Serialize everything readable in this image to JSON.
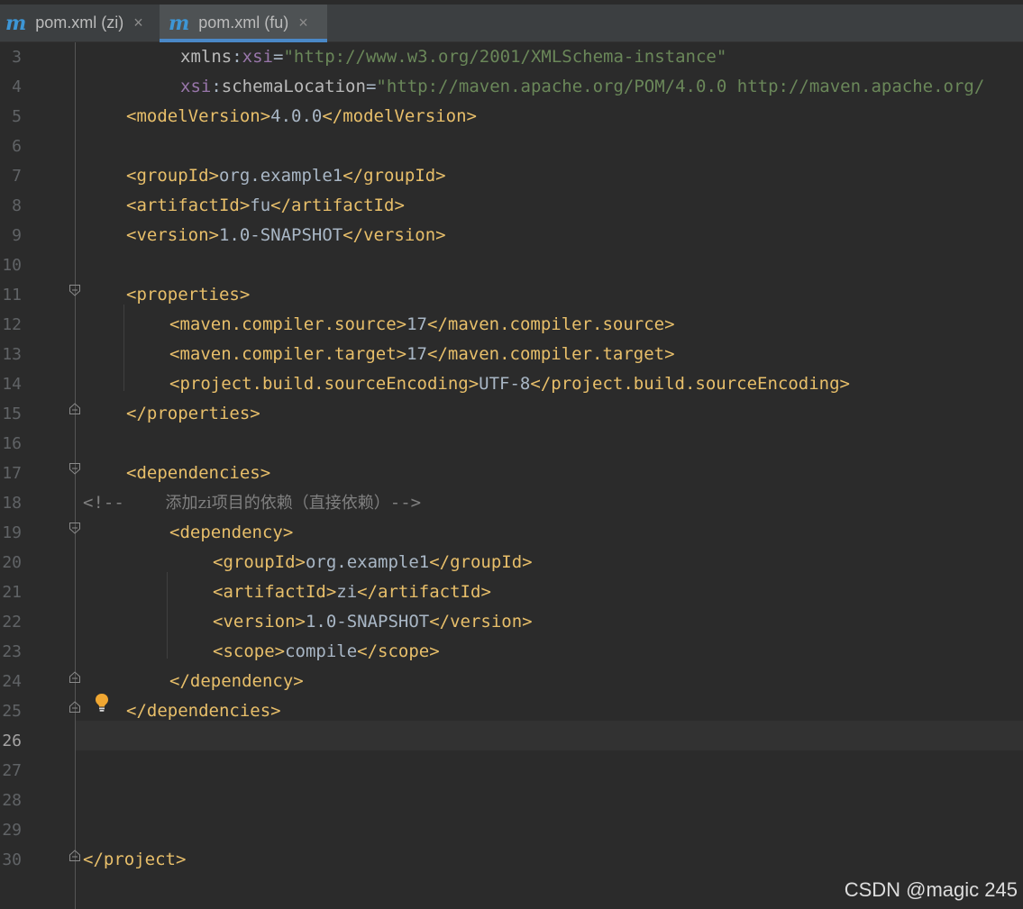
{
  "tabs": [
    {
      "label": "pom.xml (zi)",
      "icon": "maven-m-icon",
      "close": "×",
      "active": false
    },
    {
      "label": "pom.xml (fu)",
      "icon": "maven-m-icon",
      "close": "×",
      "active": true
    }
  ],
  "tab_icon_glyph": "m",
  "editor": {
    "current_line": 26,
    "lines": [
      {
        "n": "3",
        "tokens": [
          [
            "attr",
            "xmlns"
          ],
          [
            "txt",
            ":"
          ],
          [
            "ns",
            "xsi"
          ],
          [
            "txt",
            "="
          ],
          [
            "str",
            "\"http://www.w3.org/2001/XMLSchema-instance\""
          ]
        ]
      },
      {
        "n": "4",
        "tokens": [
          [
            "ns",
            "xsi"
          ],
          [
            "txt",
            ":"
          ],
          [
            "attr",
            "schemaLocation"
          ],
          [
            "txt",
            "="
          ],
          [
            "str",
            "\"http://maven.apache.org/POM/4.0.0 http://maven.apache.org/"
          ]
        ]
      },
      {
        "n": "5",
        "tokens": [
          [
            "tag",
            "<modelVersion>"
          ],
          [
            "txt",
            "4.0.0"
          ],
          [
            "tag",
            "</modelVersion>"
          ]
        ]
      },
      {
        "n": "6",
        "tokens": []
      },
      {
        "n": "7",
        "tokens": [
          [
            "tag",
            "<groupId>"
          ],
          [
            "txt",
            "org.example1"
          ],
          [
            "tag",
            "</groupId>"
          ]
        ]
      },
      {
        "n": "8",
        "tokens": [
          [
            "tag",
            "<artifactId>"
          ],
          [
            "txt",
            "fu"
          ],
          [
            "tag",
            "</artifactId>"
          ]
        ]
      },
      {
        "n": "9",
        "tokens": [
          [
            "tag",
            "<version>"
          ],
          [
            "txt",
            "1.0-SNAPSHOT"
          ],
          [
            "tag",
            "</version>"
          ]
        ]
      },
      {
        "n": "10",
        "tokens": []
      },
      {
        "n": "11",
        "tokens": [
          [
            "tag",
            "<properties>"
          ]
        ]
      },
      {
        "n": "12",
        "tokens": [
          [
            "tag",
            "<maven.compiler.source>"
          ],
          [
            "txt",
            "17"
          ],
          [
            "tag",
            "</maven.compiler.source>"
          ]
        ]
      },
      {
        "n": "13",
        "tokens": [
          [
            "tag",
            "<maven.compiler.target>"
          ],
          [
            "txt",
            "17"
          ],
          [
            "tag",
            "</maven.compiler.target>"
          ]
        ]
      },
      {
        "n": "14",
        "tokens": [
          [
            "tag",
            "<project.build.sourceEncoding>"
          ],
          [
            "txt",
            "UTF-8"
          ],
          [
            "tag",
            "</project.build.sourceEncoding>"
          ]
        ]
      },
      {
        "n": "15",
        "tokens": [
          [
            "tag",
            "</properties>"
          ]
        ]
      },
      {
        "n": "16",
        "tokens": []
      },
      {
        "n": "17",
        "tokens": [
          [
            "tag",
            "<dependencies>"
          ]
        ]
      },
      {
        "n": "18",
        "tokens": [
          [
            "cmt",
            "<!--"
          ],
          [
            "cmtcn",
            "        添加zi项目的依赖（直接依赖）"
          ],
          [
            "cmt",
            "-->"
          ]
        ]
      },
      {
        "n": "19",
        "tokens": [
          [
            "tag",
            "<dependency>"
          ]
        ]
      },
      {
        "n": "20",
        "tokens": [
          [
            "tag",
            "<groupId>"
          ],
          [
            "txt",
            "org.example1"
          ],
          [
            "tag",
            "</groupId>"
          ]
        ]
      },
      {
        "n": "21",
        "tokens": [
          [
            "tag",
            "<artifactId>"
          ],
          [
            "txt",
            "zi"
          ],
          [
            "tag",
            "</artifactId>"
          ]
        ]
      },
      {
        "n": "22",
        "tokens": [
          [
            "tag",
            "<version>"
          ],
          [
            "txt",
            "1.0-SNAPSHOT"
          ],
          [
            "tag",
            "</version>"
          ]
        ]
      },
      {
        "n": "23",
        "tokens": [
          [
            "tag",
            "<scope>"
          ],
          [
            "txt",
            "compile"
          ],
          [
            "tag",
            "</scope>"
          ]
        ]
      },
      {
        "n": "24",
        "tokens": [
          [
            "tag",
            "</dependency>"
          ]
        ]
      },
      {
        "n": "25",
        "tokens": [
          [
            "tag",
            "</dependencies>"
          ]
        ]
      },
      {
        "n": "26",
        "tokens": []
      },
      {
        "n": "27",
        "tokens": []
      },
      {
        "n": "28",
        "tokens": []
      },
      {
        "n": "29",
        "tokens": []
      },
      {
        "n": "30",
        "tokens": [
          [
            "tag",
            "</project>"
          ]
        ]
      }
    ]
  },
  "colors": {
    "background": "#2b2b2b",
    "tag": "#e8bf6a",
    "text": "#a9b7c6",
    "namespace": "#9876aa",
    "string": "#6a8759",
    "comment": "#808080",
    "line_number": "#606366",
    "tab_accent": "#4a88c7"
  },
  "watermark": "CSDN @magic 245"
}
